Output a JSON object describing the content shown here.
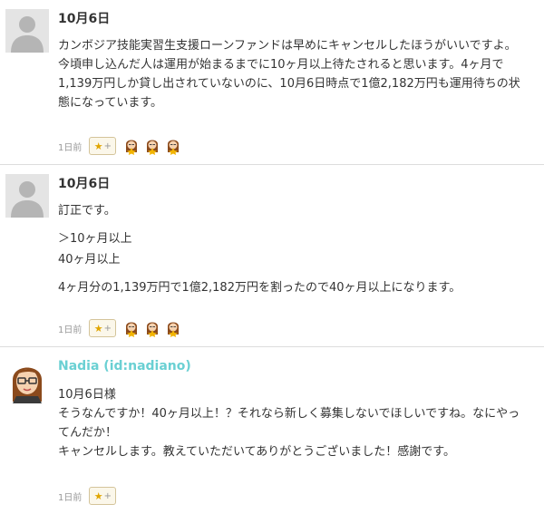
{
  "comments": [
    {
      "name": "10月6日",
      "paragraphs": [
        "カンボジア技能実習生支援ローンファンドは早めにキャンセルしたほうがいいですよ。今頃申し込んだ人は運用が始まるまでに10ヶ月以上待たされると思います。4ヶ月で1,139万円しか貸し出されていないのに、10月6日時点で1億2,182万円も運用待ちの状態になっています。"
      ],
      "time": "1日前",
      "star_label": "★",
      "star_plus": "+"
    },
    {
      "name": "10月6日",
      "paragraphs": [
        "訂正です。",
        "＞10ヶ月以上",
        "40ヶ月以上",
        "4ヶ月分の1,139万円で1億2,182万円を割ったので40ヶ月以上になります。"
      ],
      "time": "1日前",
      "star_label": "★",
      "star_plus": "+"
    },
    {
      "name": "Nadia (id:nadiano)",
      "paragraphs": [
        "10月6日様",
        "そうなんですか！40ヶ月以上！？それなら新しく募集しないでほしいですね。なにやってんだか！",
        "キャンセルします。教えていただいてありがとうございました！感謝です。"
      ],
      "time": "1日前",
      "star_label": "★",
      "star_plus": "+"
    }
  ],
  "colors": {
    "username": "#6ad0d3",
    "star": "#e0a500",
    "divider": "#dddddd"
  }
}
